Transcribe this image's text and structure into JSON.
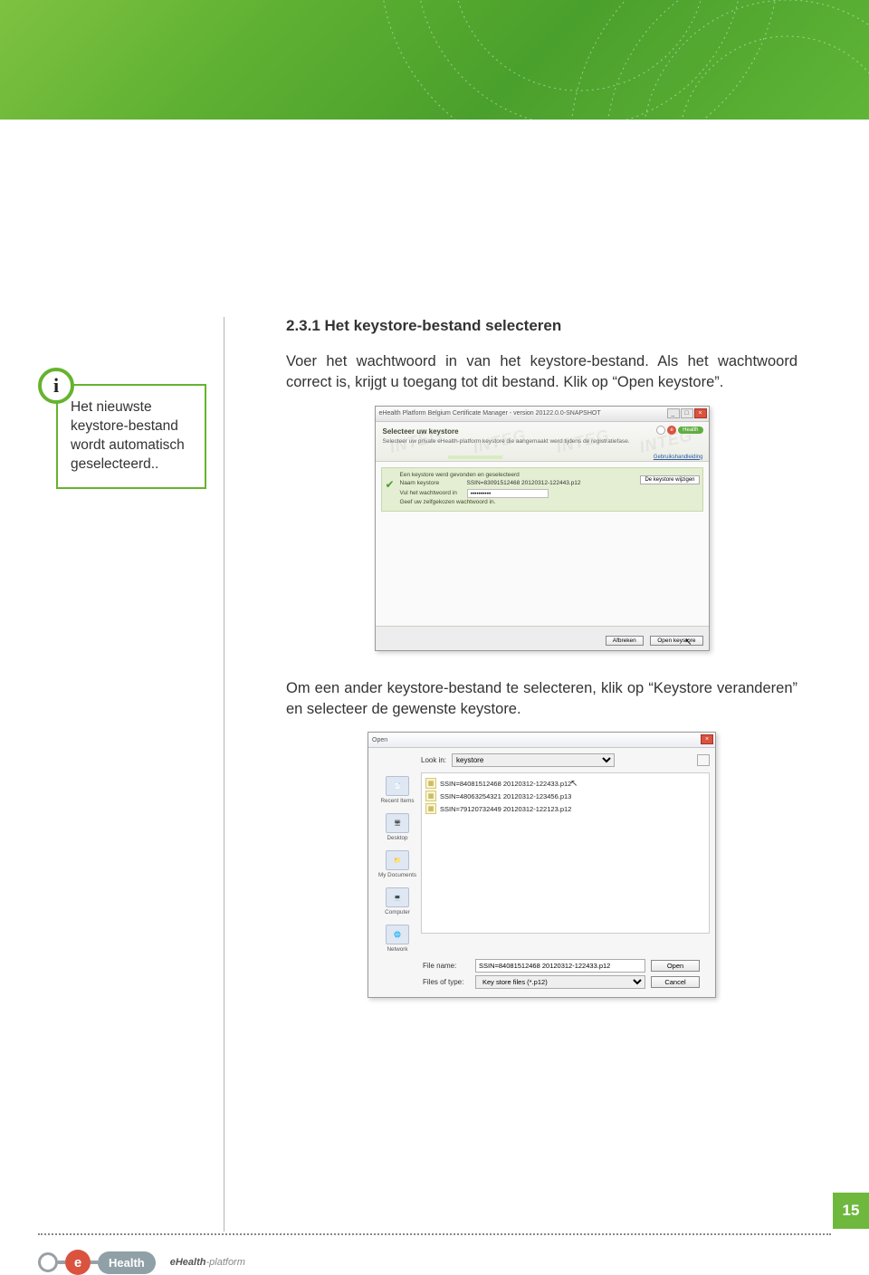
{
  "banner": {},
  "callout": {
    "icon": "i",
    "text": "Het nieuwste keystore-bestand wordt automatisch geselecteerd.."
  },
  "section": {
    "heading": "2.3.1 Het keystore-bestand selecteren",
    "p1": "Voer het wachtwoord in van het keystore-bestand. Als het wachtwoord correct is, krijgt u toegang tot dit bestand.  Klik op “Open keystore”.",
    "p2": "Om een ander keystore-bestand te selecteren, klik op “Keystore veranderen” en selecteer de gewenste keystore."
  },
  "shot1": {
    "title": "eHealth Platform Belgium Certificate Manager - version 20122.0.0-SNAPSHOT",
    "headerTitle": "Selecteer uw keystore",
    "headerSub": "Selecteer uw private eHealth-platform keystore die aangemaakt werd tijdens de registratiefase.",
    "userlink": "Gebruikshandleiding",
    "watermark": "INTEG",
    "found": "Een keystore werd gevonden en geselecteerd",
    "nameLbl": "Naam keystore",
    "nameVal": "SSIN=83091512468 20120312-122443.p12",
    "pwLbl": "Vul het wachtwoord in",
    "pwVal": "••••••••••",
    "hint": "Geef uw zelfgekozen wachtwoord in.",
    "changeBtn": "De keystore wijzigen",
    "cancel": "Afbreken",
    "open": "Open keystore"
  },
  "shot2": {
    "title": "Open",
    "lookin": "Look in:",
    "folder": "keystore",
    "places": [
      "Recent Items",
      "Desktop",
      "My Documents",
      "Computer",
      "Network"
    ],
    "files": [
      "SSIN=84081512468 20120312-122433.p12",
      "SSIN=48063254321 20120312-123456.p13",
      "SSIN=79120732449 20120312-122123.p12"
    ],
    "fnameLbl": "File name:",
    "fnameVal": "SSIN=84081512468 20120312-122433.p12",
    "ftypeLbl": "Files of type:",
    "ftypeVal": "Key store files (*.p12)",
    "open": "Open",
    "cancel": "Cancel"
  },
  "logo": {
    "e": "e",
    "health": "Health",
    "pill": "Health"
  },
  "footer": {
    "page": "15",
    "brand_b": "eHealth",
    "brand_i": "-platform"
  }
}
